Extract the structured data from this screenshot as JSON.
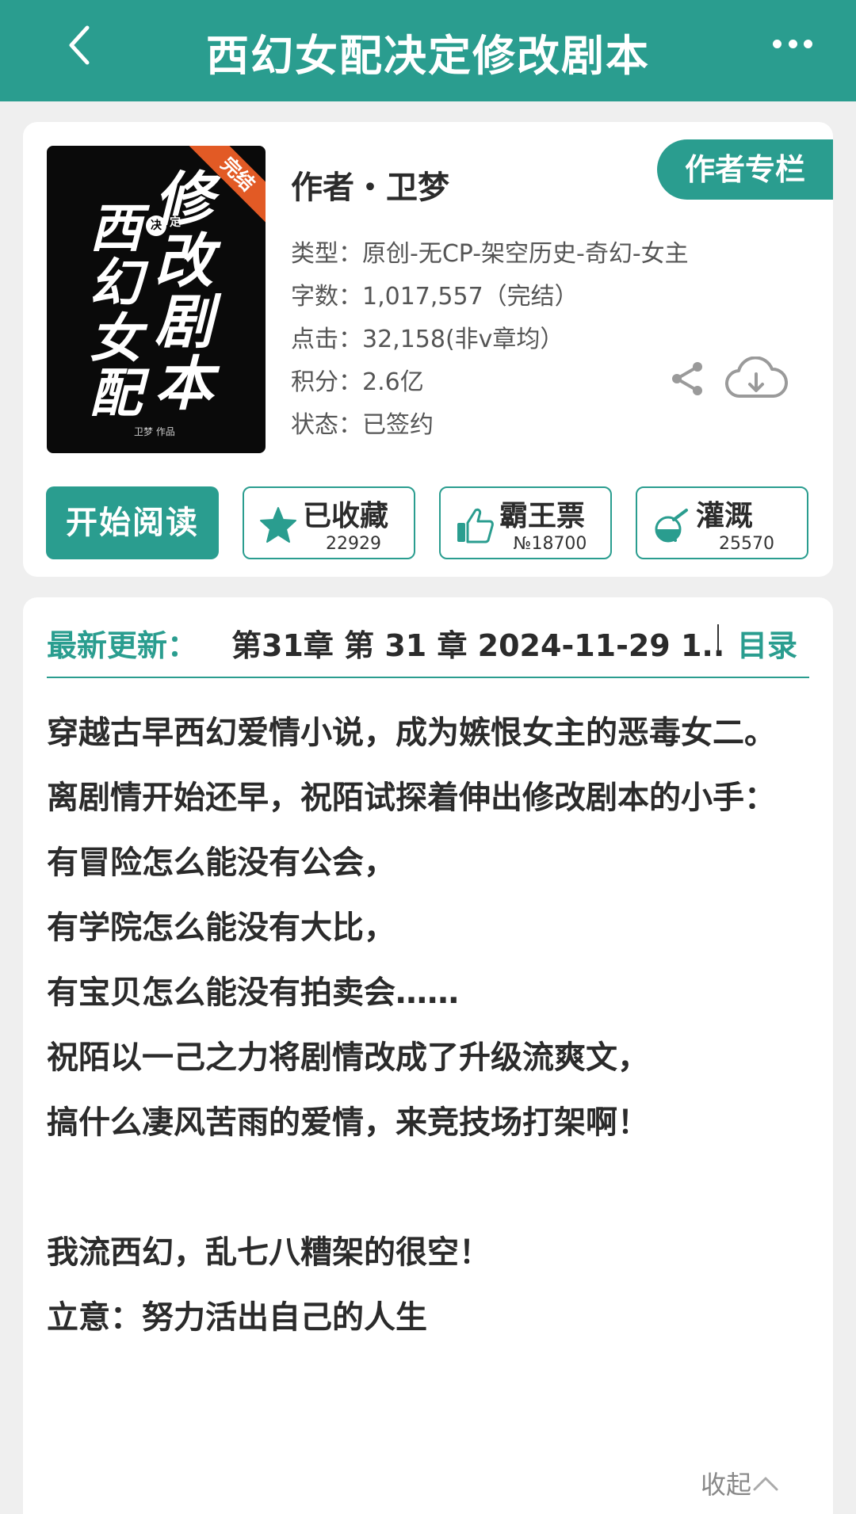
{
  "header": {
    "title": "西幻女配决定修改剧本"
  },
  "book": {
    "cover": {
      "calligraphy_1": "修改剧本",
      "calligraphy_2": "西幻女配",
      "small_1": "决",
      "small_2": "定",
      "ribbon": "完结",
      "credit": "卫梦 作品"
    },
    "author_label": "作者・卫梦",
    "author_column": "作者专栏",
    "meta": [
      "类型：原创-无CP-架空历史-奇幻-女主",
      "字数：1,017,557（完结）",
      "点击：32,158(非v章均）",
      "积分：2.6亿",
      "状态：已签约"
    ],
    "start_reading": "开始阅读",
    "stats": [
      {
        "label": "已收藏",
        "value": "22929",
        "icon": "star-icon"
      },
      {
        "label": "霸王票",
        "value": "№18700",
        "icon": "thumbs-up-icon"
      },
      {
        "label": "灌溉",
        "value": "25570",
        "icon": "watering-flask-icon"
      }
    ]
  },
  "latest": {
    "label": "最新更新：",
    "value": "第31章  第 31 章  2024-11-29 1..",
    "toc": "目录"
  },
  "description": [
    "穿越古早西幻爱情小说，成为嫉恨女主的恶毒女二。",
    "离剧情开始还早，祝陌试探着伸出修改剧本的小手：",
    "有冒险怎么能没有公会，",
    "有学院怎么能没有大比，",
    "有宝贝怎么能没有拍卖会……",
    "祝陌以一己之力将剧情改成了升级流爽文，",
    "搞什么凄风苦雨的爱情，来竞技场打架啊！",
    "",
    "我流西幻，乱七八糟架的很空！",
    "立意：努力活出自己的人生"
  ],
  "collapse_label": "收起",
  "colors": {
    "accent": "#2a9d8f",
    "background": "#efefef",
    "ribbon": "#e25a25"
  }
}
